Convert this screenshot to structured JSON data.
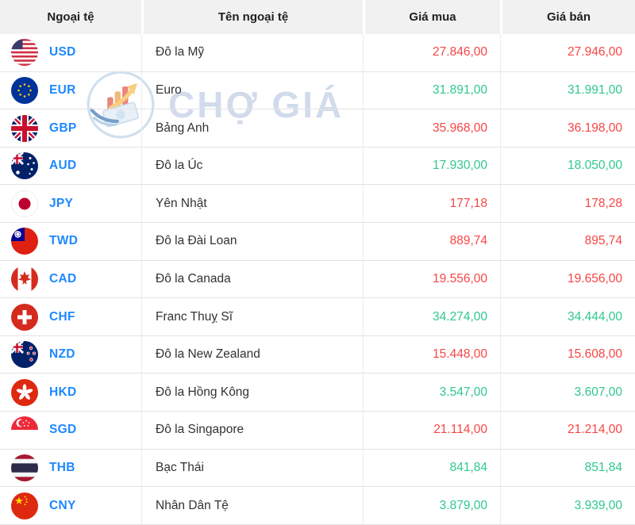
{
  "table": {
    "columns": [
      {
        "label": "Ngoại tệ"
      },
      {
        "label": "Tên ngoại tệ"
      },
      {
        "label": "Giá mua"
      },
      {
        "label": "Giá bán"
      }
    ],
    "rows": [
      {
        "code": "USD",
        "flag": "us-flag-icon",
        "name": "Đô la Mỹ",
        "buy": "27.846,00",
        "sell": "27.946,00",
        "direction": "down"
      },
      {
        "code": "EUR",
        "flag": "eu-flag-icon",
        "name": "Euro",
        "buy": "31.891,00",
        "sell": "31.991,00",
        "direction": "up"
      },
      {
        "code": "GBP",
        "flag": "gb-flag-icon",
        "name": "Bảng Anh",
        "buy": "35.968,00",
        "sell": "36.198,00",
        "direction": "down"
      },
      {
        "code": "AUD",
        "flag": "au-flag-icon",
        "name": "Đô la Úc",
        "buy": "17.930,00",
        "sell": "18.050,00",
        "direction": "up"
      },
      {
        "code": "JPY",
        "flag": "jp-flag-icon",
        "name": "Yên Nhật",
        "buy": "177,18",
        "sell": "178,28",
        "direction": "down"
      },
      {
        "code": "TWD",
        "flag": "tw-flag-icon",
        "name": "Đô la Đài Loan",
        "buy": "889,74",
        "sell": "895,74",
        "direction": "down"
      },
      {
        "code": "CAD",
        "flag": "ca-flag-icon",
        "name": "Đô la Canada",
        "buy": "19.556,00",
        "sell": "19.656,00",
        "direction": "down"
      },
      {
        "code": "CHF",
        "flag": "ch-flag-icon",
        "name": "Franc Thuỵ Sĩ",
        "buy": "34.274,00",
        "sell": "34.444,00",
        "direction": "up"
      },
      {
        "code": "NZD",
        "flag": "nz-flag-icon",
        "name": "Đô la New Zealand",
        "buy": "15.448,00",
        "sell": "15.608,00",
        "direction": "down"
      },
      {
        "code": "HKD",
        "flag": "hk-flag-icon",
        "name": "Đô la Hồng Kông",
        "buy": "3.547,00",
        "sell": "3.607,00",
        "direction": "up"
      },
      {
        "code": "SGD",
        "flag": "sg-flag-icon",
        "name": "Đô la Singapore",
        "buy": "21.114,00",
        "sell": "21.214,00",
        "direction": "down"
      },
      {
        "code": "THB",
        "flag": "th-flag-icon",
        "name": "Bạc Thái",
        "buy": "841,84",
        "sell": "851,84",
        "direction": "up"
      },
      {
        "code": "CNY",
        "flag": "cn-flag-icon",
        "name": "Nhân Dân Tệ",
        "buy": "3.879,00",
        "sell": "3.939,00",
        "direction": "up"
      }
    ]
  },
  "watermark": {
    "text": "CHỢ GIÁ"
  },
  "colors": {
    "price_up": "#2fc98c",
    "price_down": "#f84545",
    "code_blue": "#1e88ff",
    "header_bg": "#f1f1f1"
  }
}
